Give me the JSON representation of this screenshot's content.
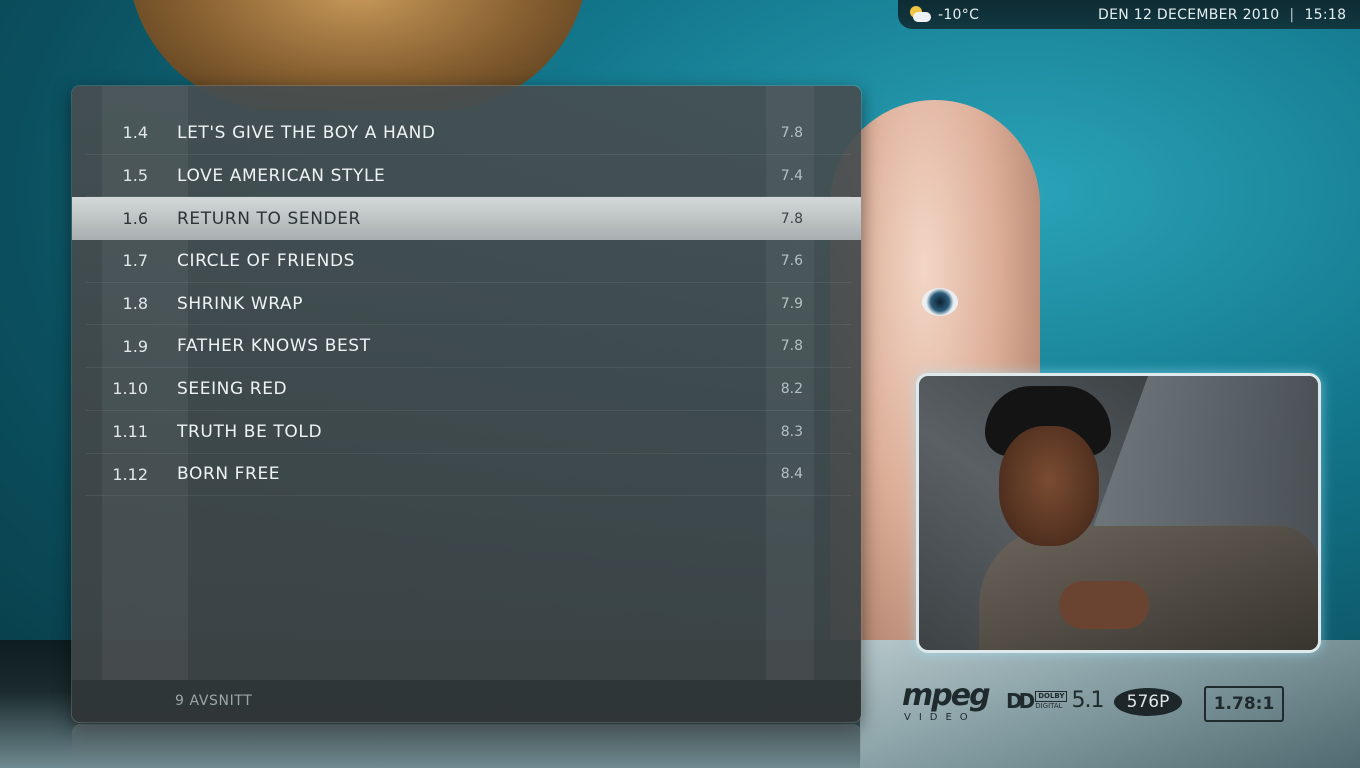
{
  "status_bar": {
    "weather_icon": "partly-cloudy-icon",
    "temperature": "-10°C",
    "date": "DEN 12 DECEMBER 2010",
    "separator": "|",
    "time": "15:18"
  },
  "episodes": [
    {
      "number": "1.4",
      "title": "LET'S GIVE THE BOY A HAND",
      "rating": "7.8"
    },
    {
      "number": "1.5",
      "title": "LOVE AMERICAN STYLE",
      "rating": "7.4"
    },
    {
      "number": "1.6",
      "title": "RETURN TO SENDER",
      "rating": "7.8",
      "selected": true
    },
    {
      "number": "1.7",
      "title": "CIRCLE OF FRIENDS",
      "rating": "7.6"
    },
    {
      "number": "1.8",
      "title": "SHRINK WRAP",
      "rating": "7.9"
    },
    {
      "number": "1.9",
      "title": "FATHER KNOWS BEST",
      "rating": "7.8"
    },
    {
      "number": "1.10",
      "title": "SEEING RED",
      "rating": "8.2"
    },
    {
      "number": "1.11",
      "title": "TRUTH BE TOLD",
      "rating": "8.3"
    },
    {
      "number": "1.12",
      "title": "BORN FREE",
      "rating": "8.4"
    }
  ],
  "footer": {
    "episode_count": "9 AVSNITT"
  },
  "media_flags": {
    "codec": "mpeg",
    "codec_sub": "VIDEO",
    "audio_brand": "DOLBY",
    "audio_sub": "DIGITAL",
    "audio_channels": "5.1",
    "resolution": "576P",
    "aspect_ratio": "1.78:1"
  },
  "colors": {
    "background_accent": "#13778c",
    "selection": "#c4c9c9",
    "thumbnail_glow": "#a0e6ff"
  }
}
